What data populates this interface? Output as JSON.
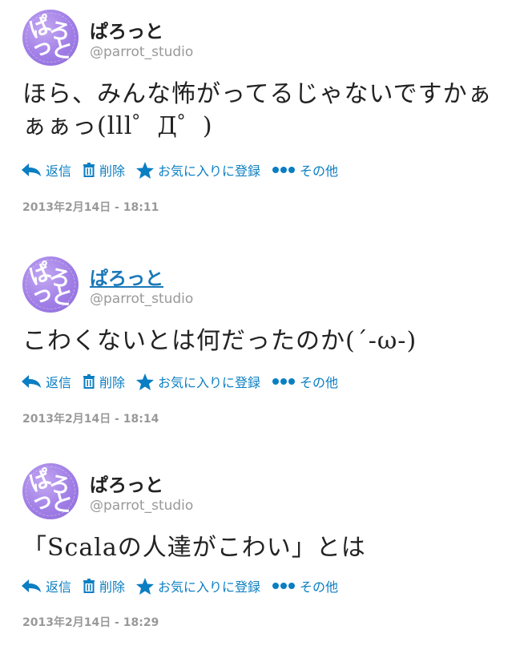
{
  "actions": {
    "reply": "返信",
    "delete": "削除",
    "favorite": "お気に入りに登録",
    "more": "その他"
  },
  "colors": {
    "link": "#0a7ec2",
    "avatar": "#a07ee6"
  },
  "tweets": [
    {
      "display_name": "ぱろっと",
      "screen_name": "@parrot_studio",
      "text": "ほら、みんな怖がってるじゃないですかぁぁぁっ(lll゜Д゜)",
      "timestamp": "2013年2月14日 - 18:11"
    },
    {
      "display_name": "ぱろっと",
      "screen_name": "@parrot_studio",
      "text": "こわくないとは何だったのか(´-ω-)",
      "timestamp": "2013年2月14日 - 18:14"
    },
    {
      "display_name": "ぱろっと",
      "screen_name": "@parrot_studio",
      "text": "「Scalaの人達がこわい」とは",
      "timestamp": "2013年2月14日 - 18:29"
    }
  ]
}
